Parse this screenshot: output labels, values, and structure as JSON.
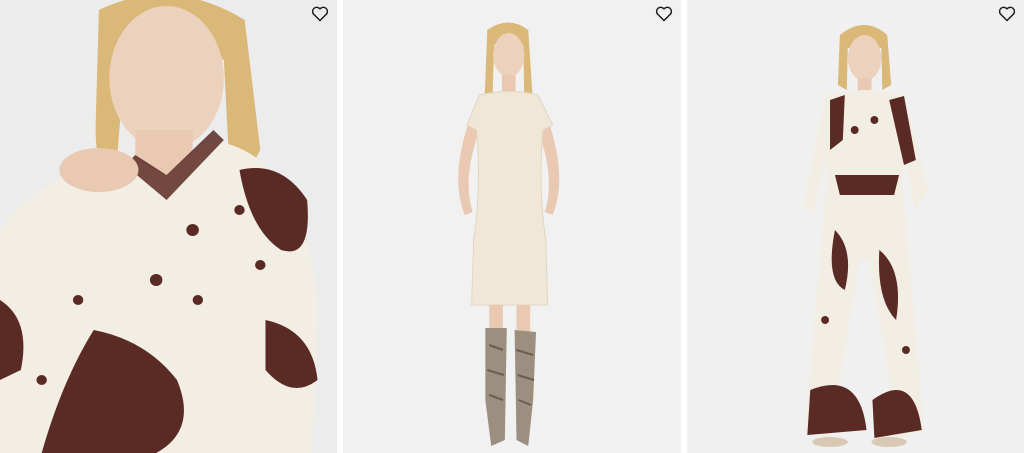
{
  "products": [
    {
      "image": "woman-in-lace-print-blouse-closeup",
      "wishlist_icon": "heart-outline-icon"
    },
    {
      "image": "woman-in-cream-sheath-dress-and-snakeskin-boots",
      "wishlist_icon": "heart-outline-icon"
    },
    {
      "image": "woman-in-lace-print-shirt-and-wide-trousers",
      "wishlist_icon": "heart-outline-icon"
    }
  ],
  "colors": {
    "background": "#efefef",
    "fabric": "#f3eee3",
    "lace_print": "#5a2a24",
    "hair": "#d9b878",
    "skin": "#e9c9b2",
    "icon": "#1a1a1a"
  }
}
